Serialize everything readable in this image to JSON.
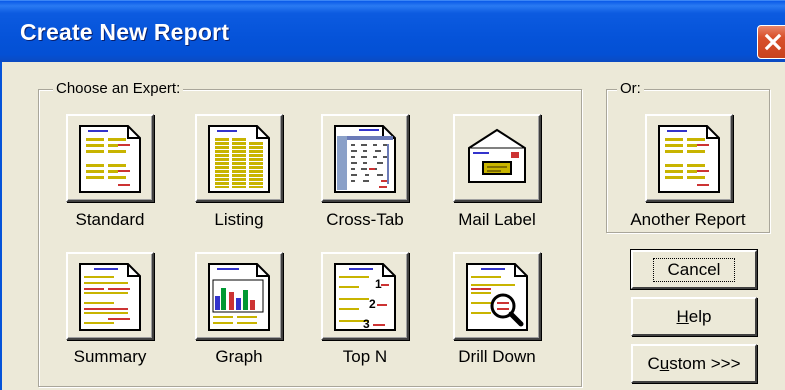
{
  "window": {
    "title": "Create New Report"
  },
  "experts_group": {
    "label": "Choose an Expert:",
    "items": [
      {
        "label": "Standard",
        "icon": "standard-report-icon"
      },
      {
        "label": "Listing",
        "icon": "listing-report-icon"
      },
      {
        "label": "Cross-Tab",
        "icon": "cross-tab-report-icon"
      },
      {
        "label": "Mail Label",
        "icon": "mail-label-icon"
      },
      {
        "label": "Summary",
        "icon": "summary-report-icon"
      },
      {
        "label": "Graph",
        "icon": "graph-report-icon"
      },
      {
        "label": "Top N",
        "icon": "top-n-report-icon"
      },
      {
        "label": "Drill Down",
        "icon": "drill-down-report-icon"
      }
    ]
  },
  "or_group": {
    "label": "Or:",
    "item": {
      "label": "Another Report",
      "icon": "another-report-icon"
    }
  },
  "buttons": {
    "cancel": "Cancel",
    "help_prefix": "",
    "help_mnemonic": "H",
    "help_rest": "elp",
    "custom_prefix": "C",
    "custom_mnemonic": "u",
    "custom_rest": "stom >>>"
  },
  "colors": {
    "titlebar": "#0553D9",
    "close_button": "#D9512C",
    "dialog_face": "#ECE9D8"
  }
}
